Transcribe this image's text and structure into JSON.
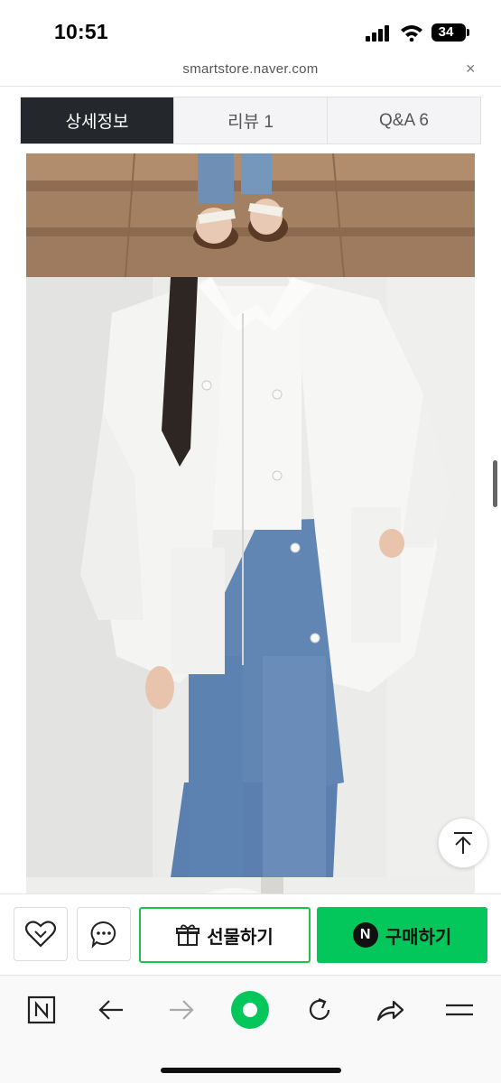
{
  "status_bar": {
    "time": "10:51",
    "battery": "34"
  },
  "browser": {
    "url": "smartstore.naver.com",
    "close_symbol": "×"
  },
  "tabs": [
    {
      "label": "상세정보",
      "active": true
    },
    {
      "label": "리뷰  1",
      "active": false
    },
    {
      "label": "Q&A  6",
      "active": false
    }
  ],
  "actions": {
    "gift_label": "선물하기",
    "buy_label": "구매하기",
    "buy_badge": "N"
  },
  "icons": {
    "wishlist": "heart-icon",
    "chat": "chat-bubble-icon",
    "gift": "gift-icon",
    "scroll_top": "arrow-up-icon",
    "nav": [
      "naver-n-icon",
      "back-arrow-icon",
      "forward-arrow-icon",
      "green-dot-icon",
      "reload-icon",
      "share-icon",
      "menu-icon"
    ]
  },
  "colors": {
    "accent": "#03c75a",
    "tab_active_bg": "#24272b"
  }
}
